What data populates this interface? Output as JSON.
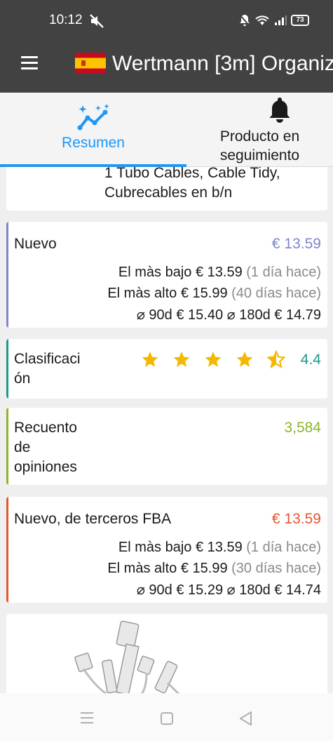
{
  "status": {
    "time": "10:12",
    "battery": "73"
  },
  "app": {
    "title": "Wertmann [3m] Organiz",
    "menu_icon": "hamburger-menu-icon",
    "flag_icon": "spain-flag-icon"
  },
  "tabs": [
    {
      "label": "Resumen",
      "icon": "trending-up-sparkle-icon",
      "active": true
    },
    {
      "label_line1": "Producto en",
      "label_line2": "seguimiento",
      "icon": "bell-icon",
      "active": false
    }
  ],
  "description": {
    "line1": "1 Tubo Cables, Cable Tidy,",
    "line2": "Cubrecables en b/n"
  },
  "nuevo": {
    "label": "Nuevo",
    "price": "€ 13.59",
    "lowest_label": "El màs bajo",
    "lowest_price": "€ 13.59",
    "lowest_ago": "(1 día hace)",
    "highest_label": "El màs alto",
    "highest_price": "€ 15.99",
    "highest_ago": "(40 días hace)",
    "avg": "⌀ 90d € 15.40 ⌀ 180d € 14.79"
  },
  "rating": {
    "label_line1": "Clasificaci",
    "label_line2": "ón",
    "value": "4.4",
    "stars": 4.5
  },
  "reviews": {
    "label_line1": "Recuento",
    "label_line2": "de",
    "label_line3": "opiniones",
    "value": "3,584"
  },
  "fba": {
    "label": "Nuevo, de terceros FBA",
    "price": "€ 13.59",
    "lowest_label": "El màs bajo",
    "lowest_price": "€ 13.59",
    "lowest_ago": "(1 día hace)",
    "highest_label": "El màs alto",
    "highest_price": "€ 15.99",
    "highest_ago": "(30 días hace)",
    "avg": "⌀ 90d € 15.29 ⌀ 180d € 14.74"
  },
  "colors": {
    "nuevo": "#7e86c9",
    "rating": "#1a9a8c",
    "reviews": "#8bb62a",
    "fba": "#e4572e",
    "accent": "#2196f3",
    "star": "#f5b800"
  }
}
